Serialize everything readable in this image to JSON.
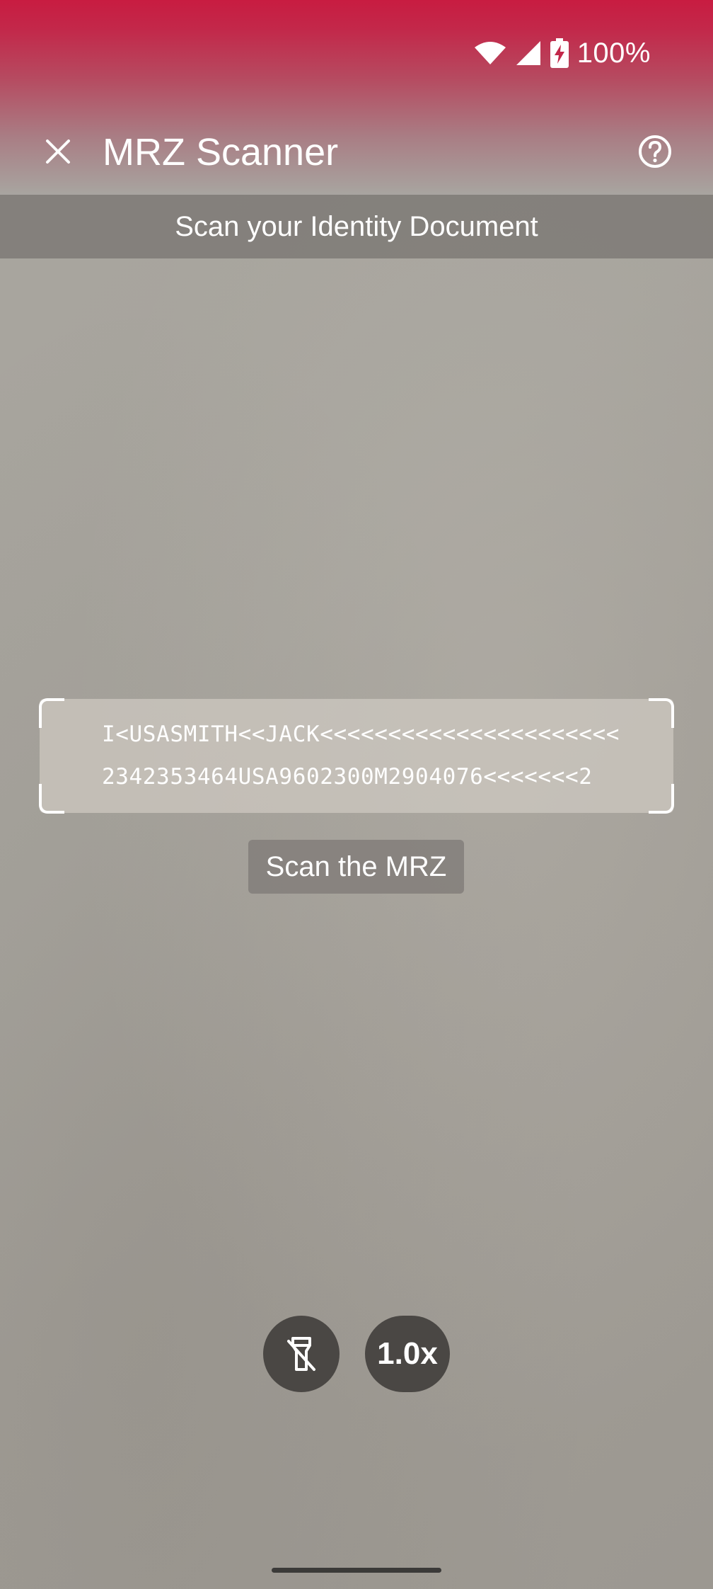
{
  "status_bar": {
    "battery_percent": "100%",
    "wifi_icon": "wifi-icon",
    "signal_icon": "cell-signal-icon",
    "battery_icon": "battery-charging-icon"
  },
  "app_bar": {
    "title": "MRZ Scanner",
    "close_icon": "close-icon",
    "help_icon": "help-circle-icon"
  },
  "banner": {
    "text": "Scan your Identity Document"
  },
  "mrz": {
    "line1": "I<USASMITH<<JACK<<<<<<<<<<<<<<<<<<<<<<",
    "line2": "2342353464USA9602300M2904076<<<<<<<2"
  },
  "hint": {
    "text": "Scan the MRZ"
  },
  "controls": {
    "flash_icon": "flash-off-icon",
    "zoom_label": "1.0x"
  },
  "colors": {
    "accent": "#c81c41",
    "control_bg": "#4a4744"
  }
}
